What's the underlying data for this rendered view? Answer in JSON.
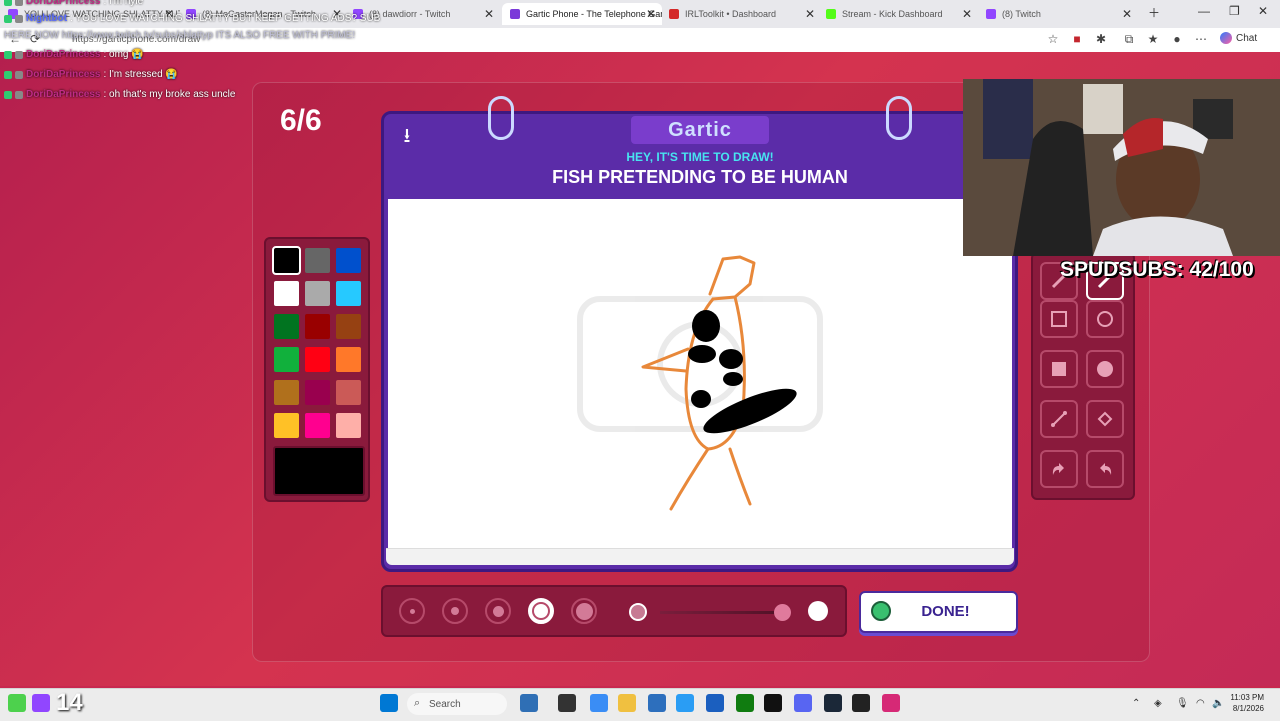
{
  "browser": {
    "tabs": [
      {
        "label": "YOU LOVE WATCHING SHLATTY BUT KEEP GETTING ADS? SUB",
        "color": "#9146ff"
      },
      {
        "label": "(8) MeGasterMegan - Twitch",
        "color": "#9146ff"
      },
      {
        "label": "(8) dawdiorr - Twitch",
        "color": "#9146ff"
      },
      {
        "label": "Gartic Phone - The Telephone Gam",
        "color": "#7b3ad9",
        "active": true
      },
      {
        "label": "IRLToolkit • Dashboard",
        "color": "#d42828"
      },
      {
        "label": "Stream - Kick Dashboard",
        "color": "#53fc18"
      },
      {
        "label": "(8) Twitch",
        "color": "#9146ff"
      }
    ],
    "url": "https://garticphone.com/draw",
    "chat_button": "Chat"
  },
  "chat": [
    {
      "user": "DoriDaPrincess",
      "message": ": I'm hyle",
      "kind": "user"
    },
    {
      "user": "Nightbot",
      "message": ": YOU LOVE WATCHING SHLATTY BUT KEEP GETTING ADS? SUB",
      "kind": "bot"
    },
    {
      "user": "",
      "message": "HERE NOW https://www.twitch.tv/subs/shlattyp ITS ALSO FREE WITH PRIME!",
      "kind": "cont"
    },
    {
      "user": "DoriDaPrincess",
      "message": ": omg 😭",
      "kind": "user"
    },
    {
      "user": "DoriDaPrincess",
      "message": ": I'm stressed 😭",
      "kind": "user"
    },
    {
      "user": "DoriDaPrincess",
      "message": ": oh that's my broke ass uncle",
      "kind": "user"
    }
  ],
  "game": {
    "round": "6/6",
    "logo": "Gartic",
    "instruction": "HEY, IT'S TIME TO DRAW!",
    "prompt": "FISH PRETENDING TO BE HUMAN",
    "done_label": "DONE!",
    "selected_color": "#000000",
    "palette": [
      "#000000",
      "#666666",
      "#0050cd",
      "#ffffff",
      "#aaaaaa",
      "#26c9ff",
      "#017420",
      "#990000",
      "#964112",
      "#11b03c",
      "#ff0013",
      "#ff7829",
      "#b0701c",
      "#99004e",
      "#cb5a57",
      "#ffc126",
      "#ff008f",
      "#feafa8"
    ],
    "brush_sizes": [
      1,
      2,
      3,
      4,
      5
    ],
    "selected_brush": 4,
    "opacity": 0.95
  },
  "stream": {
    "subs_text": "SPUDSUBS: 42/100",
    "viewer_count": "14"
  },
  "taskbar": {
    "search": "Search",
    "time": "11:03 PM",
    "date": "8/1/2026"
  }
}
